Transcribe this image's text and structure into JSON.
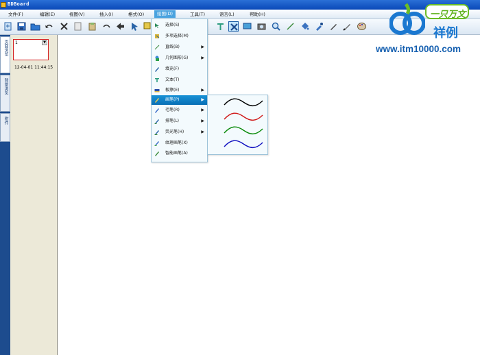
{
  "window": {
    "title": "BDBoard"
  },
  "menubar": [
    {
      "label": "文件(F)",
      "active": false
    },
    {
      "label": "编辑(E)",
      "active": false
    },
    {
      "label": "视图(V)",
      "active": false
    },
    {
      "label": "插入(I)",
      "active": false
    },
    {
      "label": "格式(O)",
      "active": false
    },
    {
      "label": "绘图(D)",
      "active": true
    },
    {
      "label": "工具(T)",
      "active": false
    },
    {
      "label": "语言(L)",
      "active": false
    },
    {
      "label": "帮助(H)",
      "active": false
    }
  ],
  "toolbar": {
    "buttons": [
      {
        "icon": "import-icon"
      },
      {
        "icon": "save-icon"
      },
      {
        "icon": "open-folder-icon"
      },
      {
        "icon": "undo-icon"
      },
      {
        "icon": "delete-icon"
      },
      {
        "icon": "cut-icon"
      },
      {
        "icon": "paste-icon"
      },
      {
        "icon": "redo-icon"
      },
      {
        "icon": "back-icon"
      },
      {
        "icon": "pointer-icon"
      },
      {
        "icon": "multi-select-icon"
      },
      {
        "icon": "text-tool-icon"
      },
      {
        "icon": "clear-icon"
      },
      {
        "icon": "screen-icon"
      },
      {
        "icon": "camera-icon"
      },
      {
        "icon": "zoom-icon"
      },
      {
        "icon": "line-tool-icon"
      },
      {
        "icon": "fill-icon"
      },
      {
        "icon": "eyedropper-icon"
      },
      {
        "icon": "pen-icon"
      },
      {
        "icon": "brush-icon"
      },
      {
        "icon": "palette-icon"
      }
    ]
  },
  "side_tabs": [
    {
      "label": "页面浏览",
      "active": true
    },
    {
      "label": "背景浏览",
      "active": false
    },
    {
      "label": "附件",
      "active": false
    }
  ],
  "page_list": {
    "thumbnail_mark": "1",
    "timestamp": "12-04-01 11:44:15"
  },
  "draw_menu": {
    "items": [
      {
        "label": "选择(S)",
        "icon": "select-icon",
        "submenu": false
      },
      {
        "label": "多项选择(M)",
        "icon": "multi-select-icon",
        "submenu": false
      },
      {
        "label": "直线(B)",
        "icon": "line-icon",
        "submenu": true
      },
      {
        "label": "几何图形(G)",
        "icon": "shapes-icon",
        "submenu": true
      },
      {
        "label": "填充(F)",
        "icon": "fill-icon",
        "submenu": false
      },
      {
        "label": "文本(T)",
        "icon": "text-icon",
        "submenu": false
      },
      {
        "label": "板擦(E)",
        "icon": "eraser-icon",
        "submenu": true
      },
      {
        "label": "画笔(P)",
        "icon": "pen-icon",
        "submenu": true,
        "highlighted": true
      },
      {
        "label": "毛笔(R)",
        "icon": "brush-icon",
        "submenu": true
      },
      {
        "label": "排笔(L)",
        "icon": "flat-brush-icon",
        "submenu": true
      },
      {
        "label": "荧光笔(H)",
        "icon": "highlighter-icon",
        "submenu": true
      },
      {
        "label": "纹理画笔(X)",
        "icon": "texture-brush-icon",
        "submenu": false
      },
      {
        "label": "智能画笔(A)",
        "icon": "smart-pen-icon",
        "submenu": false
      }
    ]
  },
  "pen_submenu": {
    "colors": [
      "#000000",
      "#d01818",
      "#0a8a0a",
      "#1010c0"
    ]
  },
  "watermark": {
    "badge": "一只万文",
    "text": "祥例",
    "url": "www.itm10000.com"
  }
}
